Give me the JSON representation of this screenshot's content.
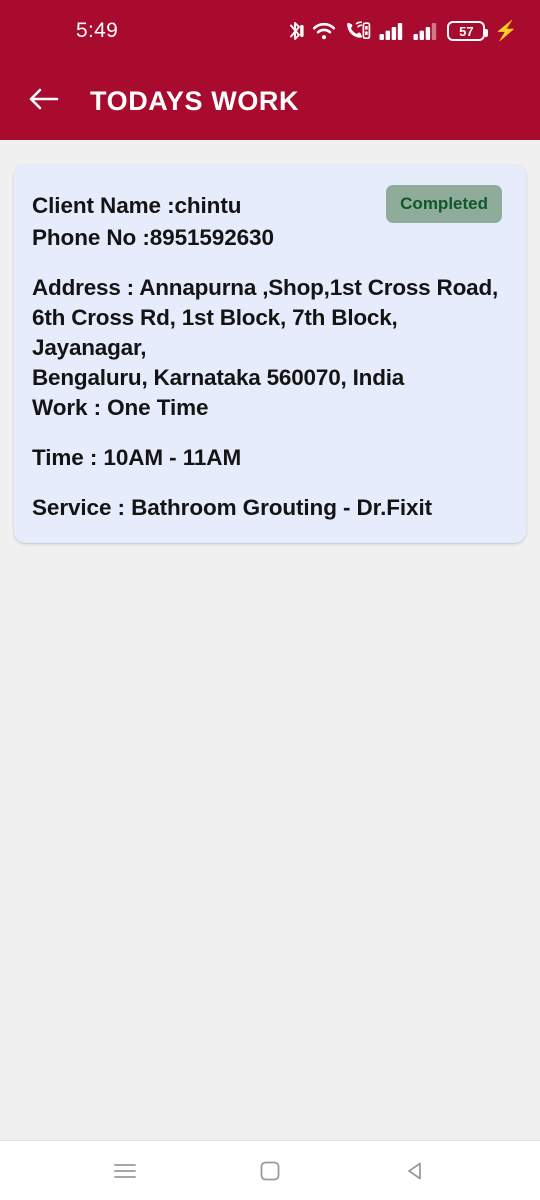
{
  "status_bar": {
    "time": "5:49",
    "battery_level": "57",
    "icons": [
      "bluetooth-icon",
      "wifi-icon",
      "call-vibrate-icon",
      "signal-bars-sim1-icon",
      "signal-bars-sim2-icon",
      "battery-icon",
      "charging-bolt-icon"
    ],
    "background_color": "#a80b2e"
  },
  "app_bar": {
    "back_label": "back-arrow",
    "title": "TODAYS WORK",
    "background_color": "#a80b2e",
    "text_color": "#ffffff"
  },
  "job_card": {
    "status_badge": "Completed",
    "badge_bg_color": "#8fac9a",
    "badge_text_color": "#11562d",
    "card_bg_color": "#e6ecfb",
    "client_name": "Client Name :chintu",
    "phone_no": "Phone No :8951592630",
    "address_lines": [
      "Address : Annapurna ,Shop,1st Cross Road,",
      "6th Cross Rd, 1st Block, 7th Block, Jayanagar,",
      "Bengaluru, Karnataka 560070, India"
    ],
    "work": "Work : One Time",
    "time": "Time : 10AM - 11AM",
    "service": "Service : Bathroom Grouting - Dr.Fixit"
  },
  "nav_bar": {
    "items": [
      "recents-icon",
      "home-icon",
      "back-icon"
    ]
  }
}
